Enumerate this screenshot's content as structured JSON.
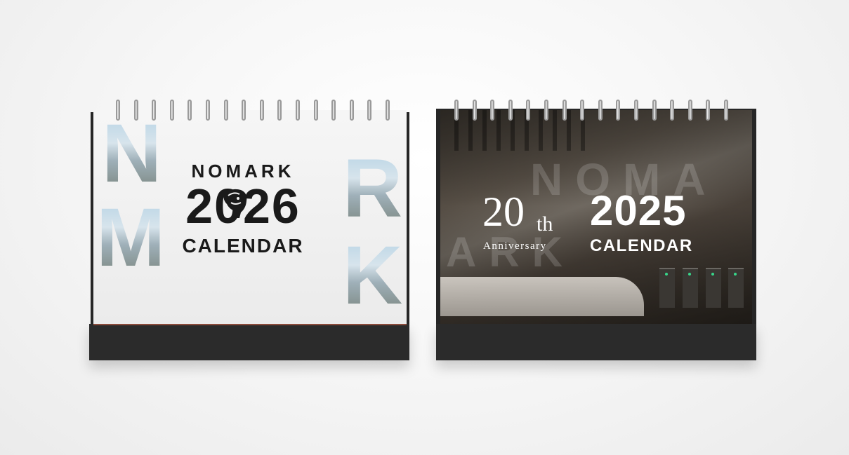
{
  "left_calendar": {
    "brand": "NOMARK",
    "year": "2026",
    "subtitle": "CALENDAR",
    "background_letters": [
      "N",
      "M",
      "R",
      "K"
    ]
  },
  "right_calendar": {
    "anniversary_number": "20",
    "anniversary_suffix": "th",
    "anniversary_label": "Anniversary",
    "year": "2025",
    "subtitle": "CALENDAR",
    "ghost_text_top": "NOMA",
    "ghost_text_bottom": "ARK"
  },
  "colors": {
    "background": "#f4f4f4",
    "stand": "#2b2b2b",
    "left_text": "#1a1a1a",
    "right_text": "#ffffff",
    "gate_light": "#38d68a"
  }
}
